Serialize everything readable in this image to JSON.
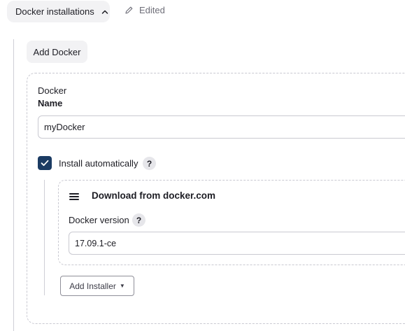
{
  "header": {
    "section_label": "Docker installations",
    "edited_label": "Edited"
  },
  "add_docker_label": "Add Docker",
  "docker": {
    "section_title": "Docker",
    "name_label": "Name",
    "name_value": "myDocker",
    "install_auto_label": "Install automatically",
    "install_auto_checked": true,
    "help_glyph": "?"
  },
  "installer": {
    "title": "Download from docker.com",
    "version_label": "Docker version",
    "version_value": "17.09.1-ce",
    "help_glyph": "?"
  },
  "add_installer_label": "Add Installer",
  "colors": {
    "checkbox": "#1b3b63",
    "pill_bg": "#f2f2f4",
    "border": "#c9c9d1"
  },
  "icons": [
    "chevron-up-icon",
    "pencil-icon",
    "check-icon",
    "help-icon",
    "drag-handle-icon",
    "caret-down-icon"
  ]
}
